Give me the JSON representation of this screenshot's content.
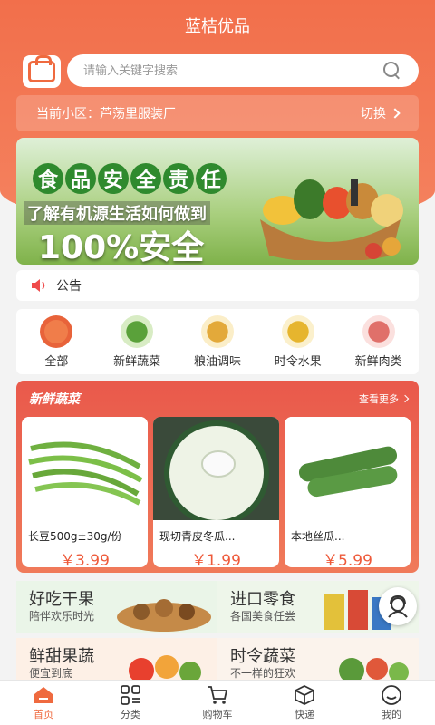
{
  "app": {
    "title": "蓝桔优品"
  },
  "search": {
    "placeholder": "请输入关键字搜索"
  },
  "community": {
    "label": "当前小区：芦荡里服装厂",
    "switch_label": "切换"
  },
  "banner": {
    "title_chars": [
      "食",
      "品",
      "安",
      "全",
      "责",
      "任"
    ],
    "subtitle": "了解有机源生活如何做到",
    "headline": "100%安全"
  },
  "notice": {
    "label": "公告"
  },
  "categories": [
    {
      "label": "全部",
      "icon": "bag-icon"
    },
    {
      "label": "新鲜蔬菜",
      "icon": "vegetable-icon"
    },
    {
      "label": "粮油调味",
      "icon": "oil-icon"
    },
    {
      "label": "时令水果",
      "icon": "pineapple-icon"
    },
    {
      "label": "新鲜肉类",
      "icon": "meat-icon"
    }
  ],
  "fresh": {
    "title": "新鲜蔬菜",
    "more_label": "查看更多",
    "products": [
      {
        "name": "长豆500g±30g/份",
        "price": "￥3.99"
      },
      {
        "name": "现切青皮冬瓜...",
        "price": "￥1.99"
      },
      {
        "name": "本地丝瓜...",
        "price": "￥5.99"
      }
    ]
  },
  "promos": [
    {
      "title": "好吃干果",
      "subtitle": "陪伴欢乐时光"
    },
    {
      "title": "进口零食",
      "subtitle": "各国美食任尝"
    },
    {
      "title": "鲜甜果蔬",
      "subtitle": "便宜到底"
    },
    {
      "title": "时令蔬菜",
      "subtitle": "不一样的狂欢"
    }
  ],
  "tabs": [
    {
      "label": "首页",
      "active": true
    },
    {
      "label": "分类",
      "active": false
    },
    {
      "label": "购物车",
      "active": false
    },
    {
      "label": "快递",
      "active": false
    },
    {
      "label": "我的",
      "active": false
    }
  ],
  "colors": {
    "brand": "#ef6a3f",
    "price": "#ee5a3a"
  }
}
